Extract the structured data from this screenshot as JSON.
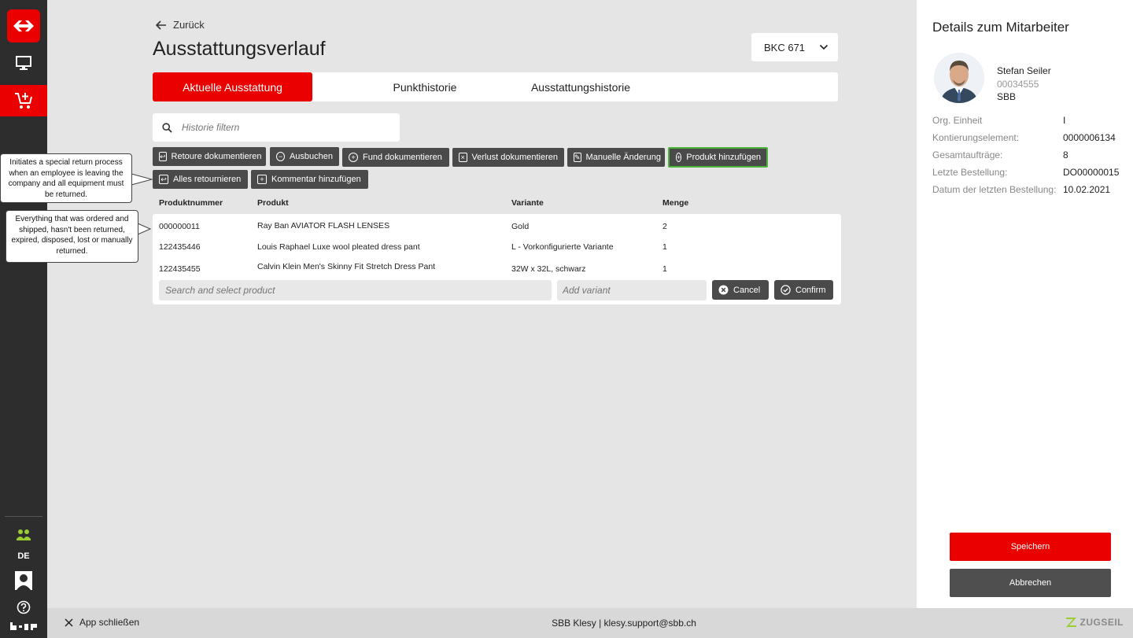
{
  "nav": {
    "language": "DE"
  },
  "page": {
    "back_label": "Zurück",
    "title": "Ausstattungsverlauf",
    "unit_select": "BKC 671"
  },
  "tabs": [
    {
      "label": "Aktuelle Ausstattung",
      "active": true
    },
    {
      "label": "Punkthistorie",
      "active": false
    },
    {
      "label": "Ausstattungshistorie",
      "active": false
    }
  ],
  "search": {
    "placeholder": "Historie filtern"
  },
  "actions": [
    {
      "label": "Retoure dokumentieren",
      "icon": "clipboard-return-icon"
    },
    {
      "label": "Ausbuchen",
      "icon": "minus-circle-icon"
    },
    {
      "label": "Fund dokumentieren",
      "icon": "plus-circle-icon"
    },
    {
      "label": "Verlust dokumentieren",
      "icon": "trash-crossed-icon"
    },
    {
      "label": "Manuelle Änderung",
      "icon": "edit-square-icon"
    },
    {
      "label": "Produkt hinzufügen",
      "icon": "plus-circle-icon"
    },
    {
      "label": "Alles retournieren",
      "icon": "clipboard-return-icon"
    },
    {
      "label": "Kommentar hinzufügen",
      "icon": "comment-plus-icon"
    }
  ],
  "table": {
    "headers": [
      "Produktnummer",
      "Produkt",
      "Variante",
      "Menge"
    ],
    "rows": [
      [
        "000000011",
        "Ray Ban AVIATOR FLASH LENSES",
        "Gold",
        "2"
      ],
      [
        "122435446",
        "Louis Raphael Luxe wool pleated dress pant",
        "L - Vorkonfigurierte Variante",
        "1"
      ],
      [
        "122435455",
        "Calvin Klein Men's Skinny Fit Stretch Dress Pant",
        "32W x 32L, schwarz",
        "1"
      ]
    ],
    "add_row": {
      "product_placeholder": "Search and select product",
      "variant_placeholder": "Add variant",
      "cancel_label": "Cancel",
      "confirm_label": "Confirm"
    }
  },
  "callouts": {
    "return_all": "Initiates a special return process when an employee is leaving the company and all equipment must be returned.",
    "table_info": "Everything that was ordered and shipped, hasn't been returned, expired, disposed, lost or manually returned."
  },
  "employee": {
    "panel_title": "Details zum Mitarbeiter",
    "name": "Stefan Seiler",
    "id": "00034555",
    "company": "SBB",
    "details": [
      {
        "label": "Org. Einheit",
        "value": "I"
      },
      {
        "label": "Kontierungselement:",
        "value": "0000006134"
      },
      {
        "label": "Gesamtaufträge:",
        "value": "8"
      },
      {
        "label": "Letzte Bestellung:",
        "value": "DO00000015"
      },
      {
        "label": "Datum der letzten Bestellung:",
        "value": "10.02.2021"
      }
    ],
    "save_label": "Speichern",
    "cancel_label": "Abbrechen"
  },
  "footer": {
    "close_label": "App schließen",
    "support": "SBB Klesy | klesy.support@sbb.ch",
    "brand": "ZUGSEIL"
  },
  "colors": {
    "accent": "#eb0000",
    "rail": "#2d2d2d",
    "action_button": "#4a4a4a",
    "highlight_border": "#4db33d"
  }
}
